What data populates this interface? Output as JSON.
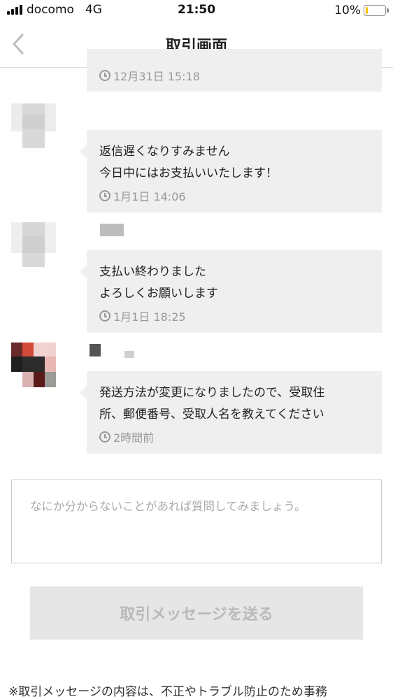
{
  "status_bar": {
    "carrier": "docomo",
    "network": "4G",
    "time": "21:50",
    "battery": "10%",
    "battery_level": 0.1
  },
  "nav": {
    "title": "取引画面",
    "back_icon": "chevron-left-icon"
  },
  "messages": [
    {
      "lines": [],
      "time": "12月31日 15:18"
    },
    {
      "lines": [
        "返信遅くなりすみません",
        "今日中にはお支払いいたします！"
      ],
      "time": "1月1日 14:06"
    },
    {
      "lines": [
        "支払い終わりました",
        "よろしくお願いします"
      ],
      "time": "1月1日 18:25"
    },
    {
      "lines": [
        "発送方法が変更になりましたので、受取住",
        "所、郵便番号、受取人名を教えてください"
      ],
      "time": "2時間前"
    }
  ],
  "composer": {
    "placeholder": "なにか分からないことがあれば質問してみましょう。",
    "value": ""
  },
  "send_button": {
    "label": "取引メッセージを送る"
  },
  "footer_note": "※取引メッセージの内容は、不正やトラブル防止のため事務",
  "colors": {
    "bubble": "#efefef",
    "meta_text": "#999999",
    "button_bg": "#e6e6e6",
    "button_text": "#b9b9b9",
    "battery": "#f2c200"
  }
}
